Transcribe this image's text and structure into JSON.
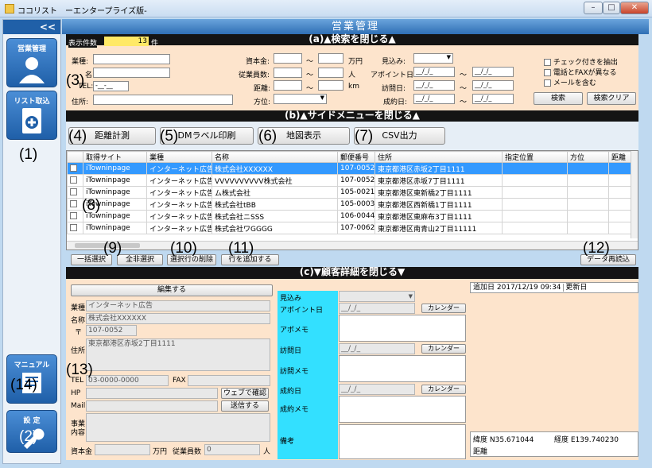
{
  "window": {
    "title": "ココリスト　ーエンタープライズ版-",
    "min": "–",
    "max": "□",
    "close": "✕"
  },
  "sidebar": {
    "collapse": "<<",
    "sales": "営業管理",
    "import": "リスト取込",
    "manual": "マニュアル",
    "settings": "設 定"
  },
  "header": {
    "title": "営業管理"
  },
  "search": {
    "section": "(a)▲検索を閉じる▲",
    "count_label": "表示件数",
    "count_value": "13",
    "count_unit": "件",
    "industry": "業種:",
    "name_lbl": "名:",
    "tel_lbl": "TEL:",
    "tel_value": "-__-__",
    "address": "住所:",
    "capital": "資本金:",
    "capital_unit": "万円",
    "employees": "従業員数:",
    "employees_unit": "人",
    "distance": "距離:",
    "distance_unit": "km",
    "direction": "方位:",
    "tilde": "～",
    "prospect": "見込み:",
    "appoint": "アポイント日:",
    "visit": "訪問日:",
    "closed": "成約日:",
    "date_ph": "__/_/_",
    "check1": "チェック付きを抽出",
    "check2": "電話とFAXが異なる",
    "check3": "メールを含む",
    "search_btn": "検索",
    "clear_btn": "検索クリア"
  },
  "menu": {
    "section": "(b)▲サイドメニューを閉じる▲",
    "distance": "距離計測",
    "dm": "DMラベル印刷",
    "map": "地図表示",
    "csv": "CSV出力"
  },
  "grid": {
    "headers": [
      "",
      "取得サイト",
      "業種",
      "名称",
      "郵便番号",
      "住所",
      "指定位置",
      "方位",
      "距離"
    ],
    "rows": [
      {
        "site": "iTowninpage",
        "industry": "インターネット広告",
        "name": "株式会社XXXXXX",
        "zip": "107-0052",
        "address": "東京都港区赤坂2丁目1111"
      },
      {
        "site": "iTowninpage",
        "industry": "インターネット広告",
        "name": "VVVVVVVVVV株式会社",
        "zip": "107-0052",
        "address": "東京都港区赤坂7丁目1111"
      },
      {
        "site": "iTowninpage",
        "industry": "インターネット広告",
        "name": "ム株式会社",
        "zip": "105-0021",
        "address": "東京都港区東新橋2丁目1111"
      },
      {
        "site": "iTowninpage",
        "industry": "インターネット広告",
        "name": "株式会社tBB",
        "zip": "105-0003",
        "address": "東京都港区西新橋1丁目1111"
      },
      {
        "site": "iTowninpage",
        "industry": "インターネット広告",
        "name": "株式会社ニSSS",
        "zip": "106-0044",
        "address": "東京都港区東麻布3丁目1111"
      },
      {
        "site": "iTowninpage",
        "industry": "インターネット広告",
        "name": "株式会社ワGGGG",
        "zip": "107-0062",
        "address": "東京都港区南青山2丁目11111"
      }
    ]
  },
  "actions": {
    "select_all": "一括選択",
    "deselect_all": "全非選択",
    "delete_rows": "選択行の削除",
    "add_row": "行を追加する",
    "reload": "データ再読込"
  },
  "detail": {
    "section": "(c)▼顧客詳細を閉じる▼",
    "edit": "編集する",
    "industry_lbl": "業種",
    "industry": "インターネット広告",
    "name_lbl": "名称",
    "name": "株式会社XXXXXX",
    "zip_mark": "〒",
    "zip": "107-0052",
    "address_lbl": "住所",
    "address": "東京都港区赤坂2丁目1111",
    "tel_lbl": "TEL",
    "tel": "03-0000-0000",
    "fax_lbl": "FAX",
    "hp_lbl": "HP",
    "web_btn": "ウェブで確認",
    "mail_lbl": "Mail",
    "send_btn": "送信する",
    "biz_lbl": "事業\n内容",
    "capital_lbl": "資本金",
    "capital_unit": "万円",
    "emp_lbl": "従業員数",
    "emp_value": "0",
    "emp_unit": "人",
    "prospect": "見込み",
    "appoint": "アポイント日",
    "appo_memo": "アポメモ",
    "visit": "訪問日",
    "visit_memo": "訪問メモ",
    "closed": "成約日",
    "closed_memo": "成約メモ",
    "remarks": "備考",
    "calendar": "カレンダー",
    "date_ph": "__/_/_",
    "added": "追加日 2017/12/19 09:34",
    "updated": "更新日",
    "lat": "緯度 N35.671044",
    "lng": "経度 E139.740230",
    "dist": "距離"
  },
  "annotations": {
    "n1": "(1)",
    "n2": "(2)",
    "n3": "(3)",
    "n4": "(4)",
    "n5": "(5)",
    "n6": "(6)",
    "n7": "(7)",
    "n8": "(8)",
    "n9": "(9)",
    "n10": "(10)",
    "n11": "(11)",
    "n12": "(12)",
    "n13": "(13)",
    "n14": "(14)"
  },
  "colors": {
    "accent": "#2f6fb5",
    "peach": "#fde4cc",
    "cyan": "#33e0ff",
    "select": "#3399ff"
  }
}
